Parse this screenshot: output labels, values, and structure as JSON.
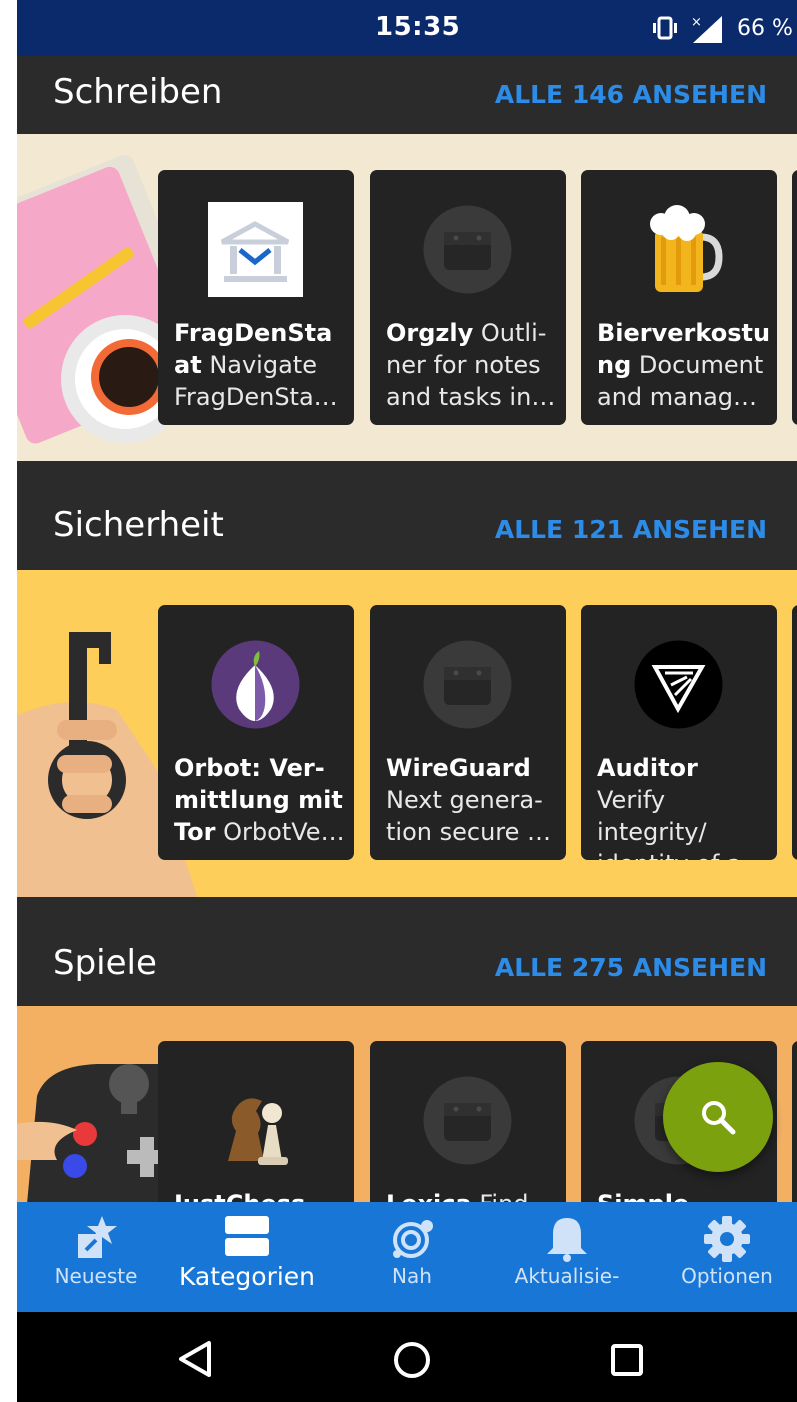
{
  "status_bar": {
    "time": "15:35",
    "battery": "66 %"
  },
  "categories": [
    {
      "title": "Schreiben",
      "see_all": "ALLE 146 ANSEHEN",
      "apps": [
        {
          "name": "FragDenSta at",
          "name_line1": "FragDenSta",
          "name_line2": "at",
          "desc": "Navigate",
          "desc2": "FragDenSta…",
          "icon": "fragdenstaat-icon"
        },
        {
          "name": "Orgzly",
          "desc": "Outli-",
          "desc2": "ner for notes",
          "desc3": "and tasks in…",
          "icon": "default-app-icon"
        },
        {
          "name": "Bierverkostung",
          "name_line1": "Bierverkostu",
          "name_line2": "ng",
          "desc": "Document",
          "desc2": "and manag…",
          "icon": "beer-icon"
        }
      ]
    },
    {
      "title": "Sicherheit",
      "see_all": "ALLE 121 ANSEHEN",
      "apps": [
        {
          "name": "Orbot: Vermittlung mit Tor",
          "name_line1": "Orbot: Ver-",
          "name_line2": "mittlung mit",
          "name_line3": "Tor",
          "desc": "OrbotVe…",
          "icon": "onion-icon"
        },
        {
          "name": "WireGuard",
          "desc": "Next genera-",
          "desc2": "tion secure …",
          "icon": "default-app-icon"
        },
        {
          "name": "Auditor",
          "desc": "Verify",
          "desc2": "integrity/",
          "desc3": "identity of a…",
          "icon": "auditor-icon"
        }
      ]
    },
    {
      "title": "Spiele",
      "see_all": "ALLE 275 ANSEHEN",
      "apps": [
        {
          "name": "JustChess",
          "icon": "chess-icon"
        },
        {
          "name": "Lexica",
          "desc": "Find",
          "icon": "default-app-icon"
        },
        {
          "name": "Simple",
          "icon": "default-app-icon"
        }
      ]
    }
  ],
  "bottom_nav": [
    {
      "label": "Neueste",
      "icon": "star-arrow-icon"
    },
    {
      "label": "Kategorien",
      "icon": "categories-icon",
      "active": true
    },
    {
      "label": "Nah",
      "icon": "nearby-icon"
    },
    {
      "label": "Aktualisie-",
      "icon": "bell-icon"
    },
    {
      "label": "Optionen",
      "icon": "gear-icon"
    }
  ],
  "fab": {
    "icon": "search-icon"
  },
  "system_nav": [
    "back-icon",
    "home-icon",
    "recents-icon"
  ],
  "colors": {
    "status_bar": "#0b2a6b",
    "header_bg": "#2b2b2b",
    "link": "#2d8ce8",
    "nav_bg": "#1877d6",
    "fab": "#7ba10e"
  }
}
